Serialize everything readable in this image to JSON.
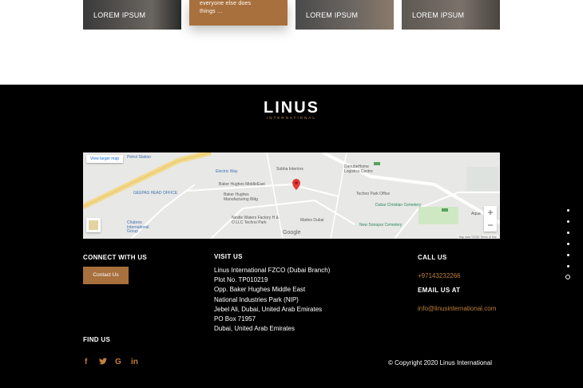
{
  "cards": [
    {
      "label": "LOREM IPSUM"
    },
    {
      "label": "everyone else does things ..."
    },
    {
      "label": "LOREM IPSUM"
    },
    {
      "label": "LOREM IPSUM"
    }
  ],
  "logo": {
    "word": "LINUS",
    "sub": "INTERNATIONAL"
  },
  "map": {
    "larger_map": "View larger map",
    "zoom_in": "+",
    "zoom_out": "−",
    "google": "Google",
    "map_data": "Map data ©2020   Terms of Use",
    "places": {
      "petrol": "Petrol Station",
      "electric": "Electric Way",
      "sobha": "Sobha Interiors",
      "danube": "DanubeHome Logistics Centre",
      "bhme": "Baker Hughes MiddleEast",
      "bhmf": "Baker Hughes Manufacturing Bldg",
      "geepas": "GEEPAS HEAD OFFICE",
      "techno": "Techno Park Office",
      "christian": "Dubai Christian Cemetery",
      "nestle": "Nestle Waters Factory H & O LLC Techno Park",
      "mattex": "Mattex Dubai",
      "chabros": "Chabros International Group",
      "sonapur": "New Sonapur Cemetery",
      "aqua": "Aqua"
    }
  },
  "connect": {
    "heading": "CONNECT WITH US",
    "button": "Contact Us"
  },
  "visit": {
    "heading": "VISIT US",
    "lines": [
      "Linus International FZCO (Dubai Branch)",
      "Plot No. TP010219",
      "Opp. Baker Hughes Middle East",
      "National Industries Park (NIP)",
      "Jebel Ali, Dubai, United Arab Emirates",
      "PO Box 71957",
      "Dubai, United Arab Emirates"
    ]
  },
  "call": {
    "heading": "CALL US",
    "phone": "+97143232266"
  },
  "email": {
    "heading": "EMAIL US AT",
    "address": "info@linusinternational.com"
  },
  "find": {
    "heading": "FIND US"
  },
  "social": {
    "facebook": "f",
    "twitter": "🐦",
    "google": "G",
    "linkedin": "in"
  },
  "copyright": "© Copyright 2020 Linus International",
  "colors": {
    "accent": "#a8703d",
    "footer_bg": "#000000"
  }
}
